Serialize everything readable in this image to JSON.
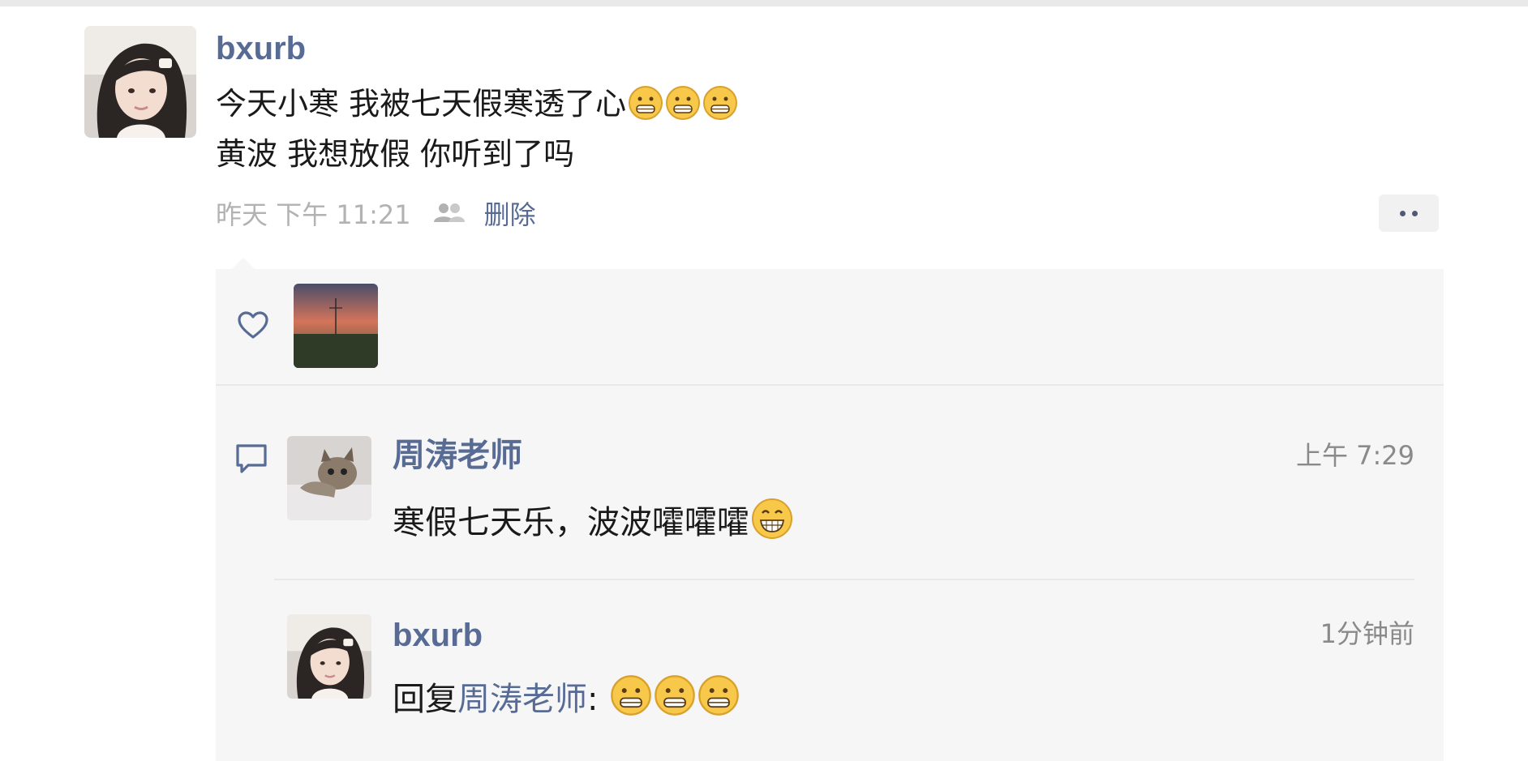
{
  "post": {
    "author": "bxurb",
    "line1": "今天小寒 我被七天假寒透了心",
    "line2": "黄波 我想放假 你听到了吗",
    "timestamp": "昨天 下午 11:21",
    "delete_label": "删除",
    "line1_emojis": [
      "grimace-emoji",
      "grimace-emoji",
      "grimace-emoji"
    ]
  },
  "comments": [
    {
      "author": "周涛老师",
      "text": "寒假七天乐，波波嚯嚯嚯",
      "time": "上午 7:29",
      "emojis": [
        "grin-emoji"
      ]
    },
    {
      "author": "bxurb",
      "reply_prefix": "回复",
      "reply_to": "周涛老师",
      "reply_suffix": ":",
      "time": "1分钟前",
      "emojis": [
        "grimace-emoji",
        "grimace-emoji",
        "grimace-emoji"
      ]
    }
  ],
  "icons": {
    "like": "heart-icon",
    "comment": "comment-icon",
    "visibility": "people-icon",
    "more": "more-dots-icon"
  },
  "colors": {
    "link": "#576b95",
    "meta_gray": "#b2b2b2",
    "panel_bg": "#f6f6f6",
    "text": "#1a1a1a"
  }
}
